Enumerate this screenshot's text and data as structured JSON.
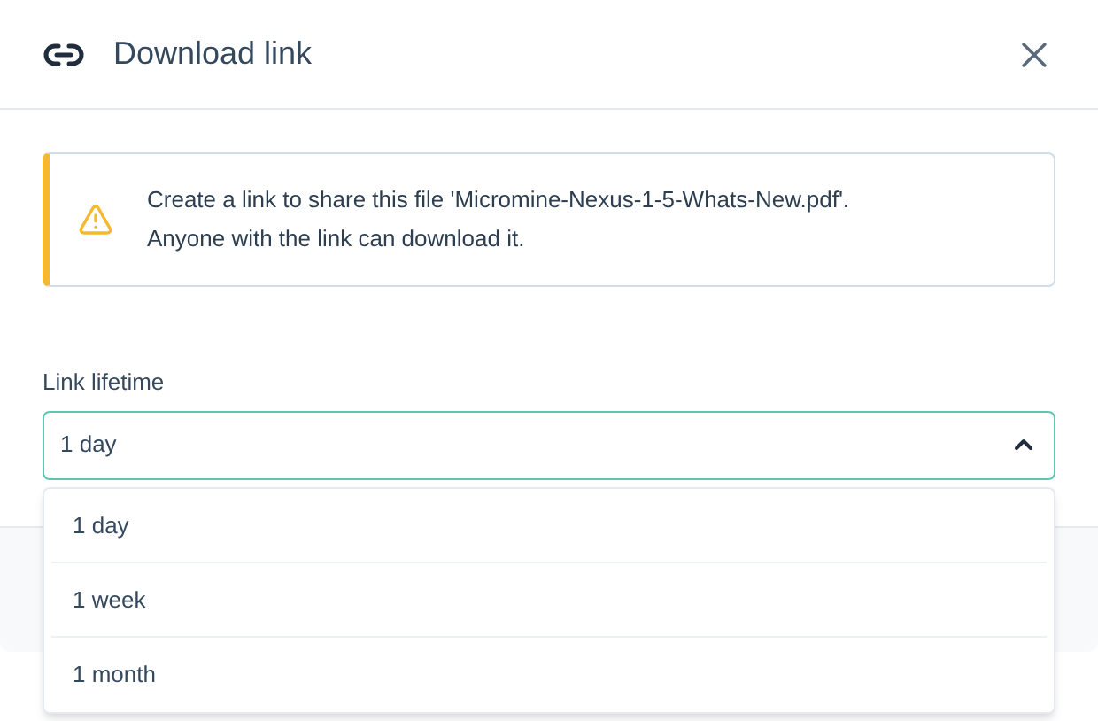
{
  "dialog": {
    "title": "Download link"
  },
  "alert": {
    "lines": [
      "Create a link to share this file 'Micromine-Nexus-1-5-Whats-New.pdf'.",
      "Anyone with the link can download it."
    ]
  },
  "field": {
    "label": "Link lifetime",
    "value": "1 day",
    "expanded": true,
    "options": [
      "1 day",
      "1 week",
      "1 month"
    ]
  }
}
